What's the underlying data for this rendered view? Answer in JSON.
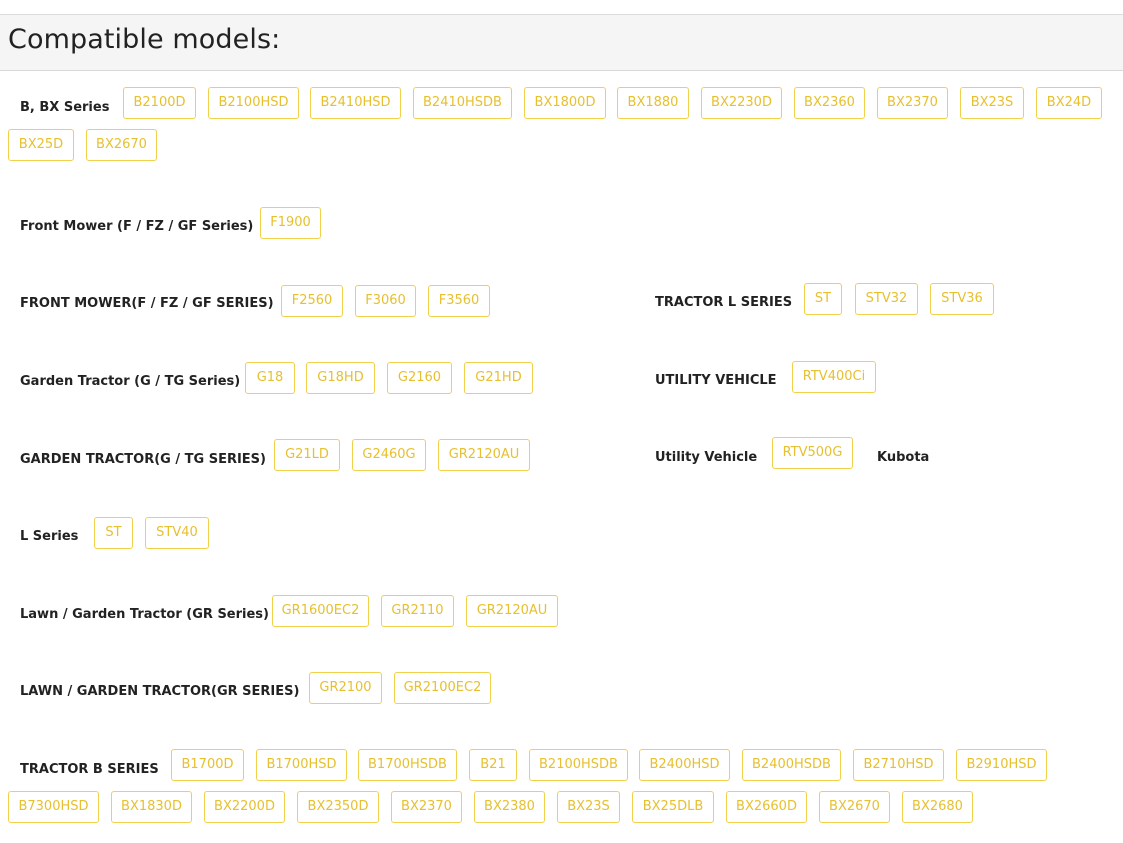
{
  "page_title": "Compatible models:",
  "groups": [
    {
      "label": "B, BX Series",
      "models": [
        "B2100D",
        "B2100HSD",
        "B2410HSD",
        "B2410HSDB",
        "BX1800D",
        "BX1880",
        "BX2230D",
        "BX2360",
        "BX2370",
        "BX23S",
        "BX24D",
        "BX25D",
        "BX2670"
      ]
    },
    {
      "label": "Front Mower (F / FZ / GF Series)",
      "models": [
        "F1900"
      ]
    },
    {
      "label": "FRONT MOWER(F / FZ / GF SERIES)",
      "models": [
        "F2560",
        "F3060",
        "F3560"
      ]
    },
    {
      "label": "Garden Tractor (G / TG Series)",
      "models": [
        "G18",
        "G18HD",
        "G2160",
        "G21HD"
      ]
    },
    {
      "label": "GARDEN TRACTOR(G / TG SERIES)",
      "models": [
        "G21LD",
        "G2460G",
        "GR2120AU"
      ]
    },
    {
      "label": "L Series",
      "models": [
        "ST",
        "STV40"
      ]
    },
    {
      "label": "Lawn / Garden Tractor (GR Series)",
      "models": [
        "GR1600EC2",
        "GR2110",
        "GR2120AU"
      ]
    },
    {
      "label": "LAWN / GARDEN TRACTOR(GR SERIES)",
      "models": [
        "GR2100",
        "GR2100EC2"
      ]
    },
    {
      "label": "TRACTOR B SERIES",
      "models": [
        "B1700D",
        "B1700HSD",
        "B1700HSDB",
        "B21",
        "B2100HSDB",
        "B2400HSD",
        "B2400HSDB",
        "B2710HSD",
        "B2910HSD",
        "B7300HSD",
        "BX1830D",
        "BX2200D",
        "BX2350D",
        "BX2370",
        "BX2380",
        "BX23S",
        "BX25DLB",
        "BX2660D",
        "BX2670",
        "BX2680"
      ]
    },
    {
      "label": "TRACTOR L SERIES",
      "models": [
        "ST",
        "STV32",
        "STV36"
      ]
    },
    {
      "label": "UTILITY VEHICLE",
      "models": [
        "RTV400Ci"
      ]
    },
    {
      "label": "Utility Vehicle",
      "models": [
        "RTV500G"
      ],
      "brand": "Kubota"
    }
  ]
}
